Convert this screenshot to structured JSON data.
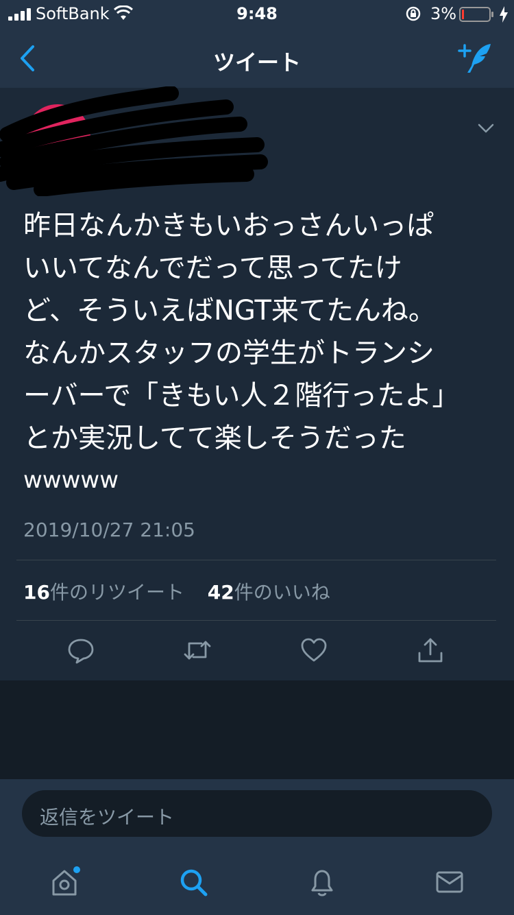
{
  "status_bar": {
    "carrier": "SoftBank",
    "time": "9:48",
    "battery": "3%"
  },
  "nav": {
    "title": "ツイート",
    "back_icon": "chevron-left-icon",
    "compose_icon": "compose-tweet-icon"
  },
  "tweet": {
    "lines": [
      "昨日なんかきもいおっさんいっぱ",
      "いいてなんでだって思ってたけ",
      "ど、そういえばNGT来てたんね。",
      "なんかスタッフの学生がトランシ",
      "ーバーで「きもい人２階行ったよ」",
      "とか実況してて楽しそうだった"
    ],
    "tail": "wwwww",
    "timestamp": "2019/10/27 21:05",
    "retweet_count": "16",
    "retweet_label": "件のリツイート",
    "like_count": "42",
    "like_label": "件のいいね"
  },
  "reply": {
    "placeholder": "返信をツイート"
  },
  "colors": {
    "bar_bg": "#243447",
    "card_bg": "#1c2938",
    "page_bg": "#141d26",
    "accent": "#1da1f2",
    "muted": "#8899a6"
  }
}
